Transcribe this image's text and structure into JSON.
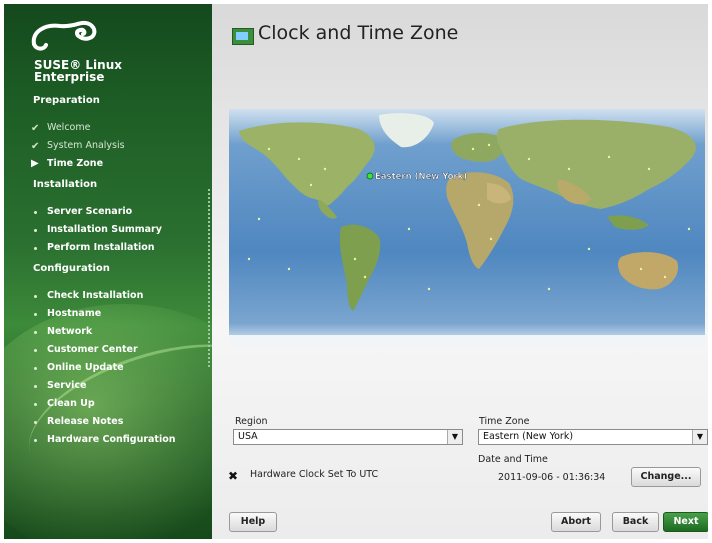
{
  "brand": {
    "line1": "SUSE® Linux",
    "line2": "Enterprise"
  },
  "sidebar": {
    "sections": [
      {
        "title": "Preparation",
        "items": [
          {
            "label": "Welcome",
            "state": "done"
          },
          {
            "label": "System Analysis",
            "state": "done"
          },
          {
            "label": "Time Zone",
            "state": "current"
          }
        ]
      },
      {
        "title": "Installation",
        "items": [
          {
            "label": "Server Scenario",
            "state": "pending"
          },
          {
            "label": "Installation Summary",
            "state": "pending"
          },
          {
            "label": "Perform Installation",
            "state": "pending"
          }
        ]
      },
      {
        "title": "Configuration",
        "items": [
          {
            "label": "Check Installation",
            "state": "pending"
          },
          {
            "label": "Hostname",
            "state": "pending"
          },
          {
            "label": "Network",
            "state": "pending"
          },
          {
            "label": "Customer Center",
            "state": "pending"
          },
          {
            "label": "Online Update",
            "state": "pending"
          },
          {
            "label": "Service",
            "state": "pending"
          },
          {
            "label": "Clean Up",
            "state": "pending"
          },
          {
            "label": "Release Notes",
            "state": "pending"
          },
          {
            "label": "Hardware Configuration",
            "state": "pending"
          }
        ]
      }
    ]
  },
  "main": {
    "title": "Clock and Time Zone",
    "map_marker_label": "Eastern (New York)",
    "region": {
      "label": "Region",
      "value": "USA"
    },
    "timezone": {
      "label": "Time Zone",
      "value": "Eastern (New York)"
    },
    "datetime": {
      "label": "Date and Time",
      "value": "2011-09-06 - 01:36:34"
    },
    "hwclock": {
      "label": "Hardware Clock Set To UTC",
      "checked": true
    },
    "buttons": {
      "change": "Change...",
      "help": "Help",
      "abort": "Abort",
      "back": "Back",
      "next": "Next"
    }
  },
  "colors": {
    "accent": "#2b7030",
    "next_button": "#2e8a32",
    "ocean": "#5a8fc2",
    "land": "#8fae5c"
  }
}
